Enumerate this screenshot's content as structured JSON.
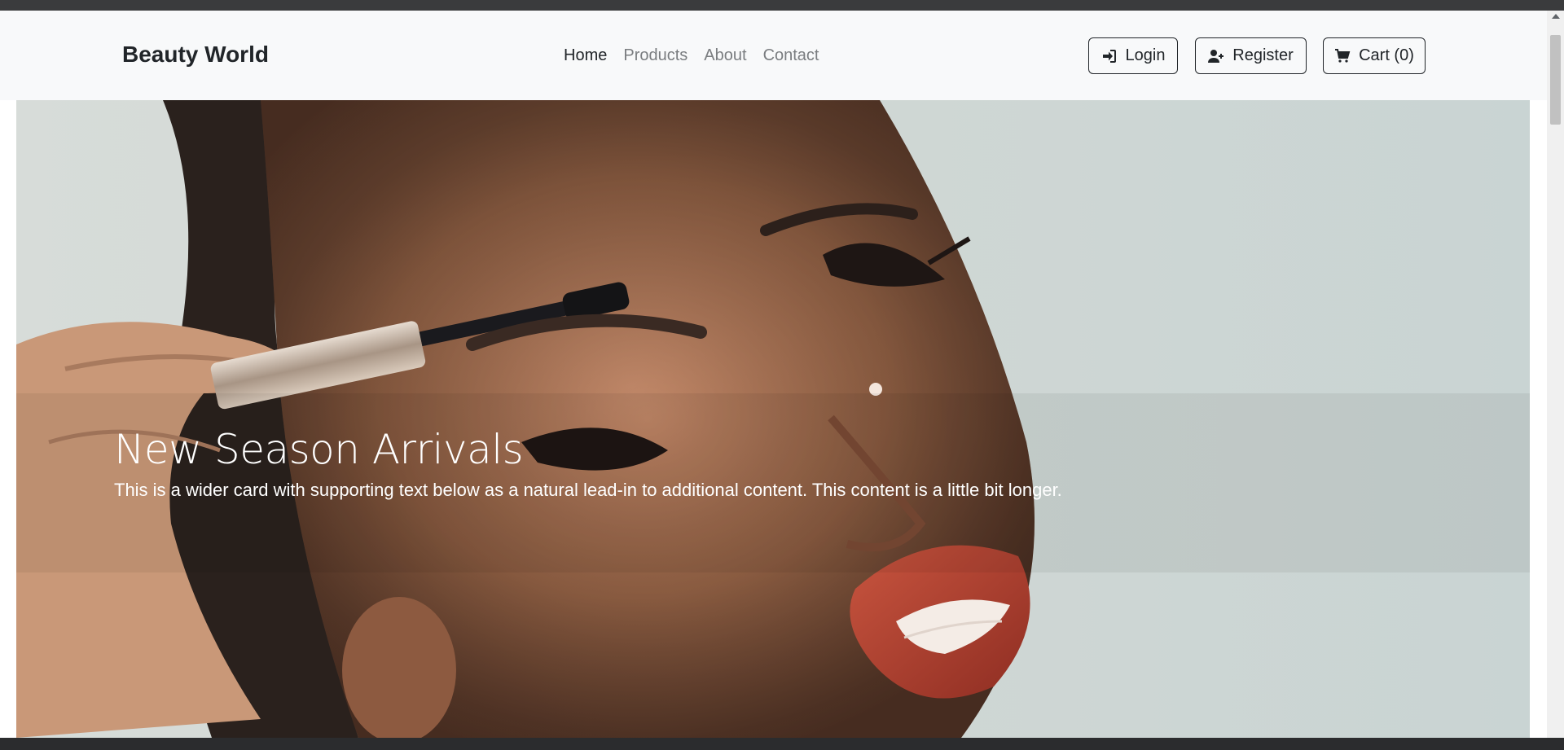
{
  "navbar": {
    "brand": "Beauty World",
    "links": [
      {
        "label": "Home",
        "active": true
      },
      {
        "label": "Products",
        "active": false
      },
      {
        "label": "About",
        "active": false
      },
      {
        "label": "Contact",
        "active": false
      }
    ],
    "buttons": {
      "login": {
        "label": "Login",
        "icon": "sign-in-icon"
      },
      "register": {
        "label": "Register",
        "icon": "user-plus-icon"
      },
      "cart": {
        "label": "Cart (0)",
        "icon": "cart-icon"
      }
    }
  },
  "hero": {
    "title": "New Season Arrivals",
    "text": "This is a wider card with supporting text below as a natural lead-in to additional content. This content is a little bit longer."
  },
  "colors": {
    "navbar_bg": "#f8f9fa",
    "text_dark": "#212529",
    "link_muted": "#7a7d80",
    "hero_text": "#ffffff"
  }
}
